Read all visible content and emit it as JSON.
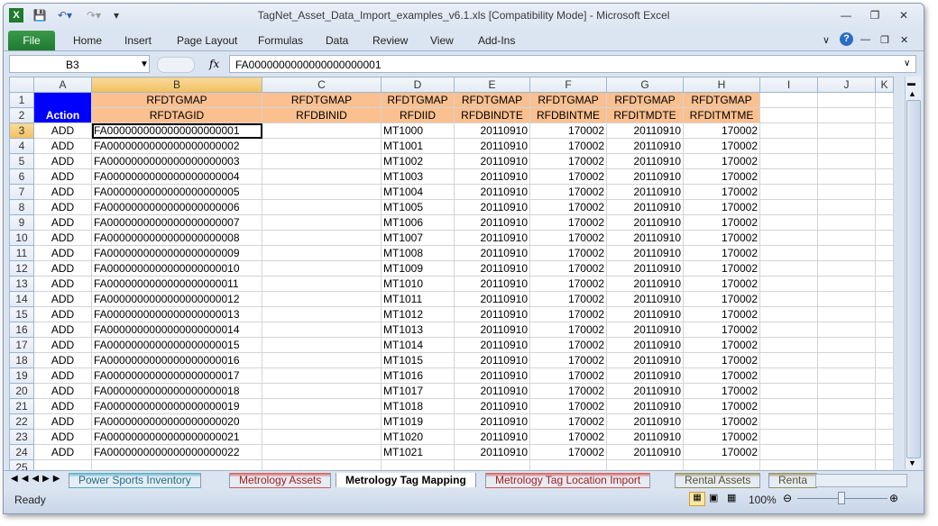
{
  "title": "TagNet_Asset_Data_Import_examples_v6.1.xls  [Compatibility Mode]  -  Microsoft Excel",
  "ribbon_tabs": [
    "File",
    "Home",
    "Insert",
    "Page Layout",
    "Formulas",
    "Data",
    "Review",
    "View",
    "Add-Ins"
  ],
  "namebox": "B3",
  "fx": "fx",
  "formula": "FA0000000000000000000001",
  "col_headers": [
    "A",
    "B",
    "C",
    "D",
    "E",
    "F",
    "G",
    "H",
    "I",
    "J",
    "K"
  ],
  "header_row1": [
    "",
    "RFDTGMAP",
    "RFDTGMAP",
    "RFDTGMAP",
    "RFDTGMAP",
    "RFDTGMAP",
    "RFDTGMAP",
    "RFDTGMAP"
  ],
  "header_row2": [
    "Action",
    "RFDTAGID",
    "RFDBINID",
    "RFDIID",
    "RFDBINDTE",
    "RFDBINTME",
    "RFDITMDTE",
    "RFDITMTME"
  ],
  "rows": [
    [
      "ADD",
      "FA0000000000000000000001",
      "",
      "MT1000",
      "20110910",
      "170002",
      "20110910",
      "170002"
    ],
    [
      "ADD",
      "FA0000000000000000000002",
      "",
      "MT1001",
      "20110910",
      "170002",
      "20110910",
      "170002"
    ],
    [
      "ADD",
      "FA0000000000000000000003",
      "",
      "MT1002",
      "20110910",
      "170002",
      "20110910",
      "170002"
    ],
    [
      "ADD",
      "FA0000000000000000000004",
      "",
      "MT1003",
      "20110910",
      "170002",
      "20110910",
      "170002"
    ],
    [
      "ADD",
      "FA0000000000000000000005",
      "",
      "MT1004",
      "20110910",
      "170002",
      "20110910",
      "170002"
    ],
    [
      "ADD",
      "FA0000000000000000000006",
      "",
      "MT1005",
      "20110910",
      "170002",
      "20110910",
      "170002"
    ],
    [
      "ADD",
      "FA0000000000000000000007",
      "",
      "MT1006",
      "20110910",
      "170002",
      "20110910",
      "170002"
    ],
    [
      "ADD",
      "FA0000000000000000000008",
      "",
      "MT1007",
      "20110910",
      "170002",
      "20110910",
      "170002"
    ],
    [
      "ADD",
      "FA0000000000000000000009",
      "",
      "MT1008",
      "20110910",
      "170002",
      "20110910",
      "170002"
    ],
    [
      "ADD",
      "FA0000000000000000000010",
      "",
      "MT1009",
      "20110910",
      "170002",
      "20110910",
      "170002"
    ],
    [
      "ADD",
      "FA0000000000000000000011",
      "",
      "MT1010",
      "20110910",
      "170002",
      "20110910",
      "170002"
    ],
    [
      "ADD",
      "FA0000000000000000000012",
      "",
      "MT1011",
      "20110910",
      "170002",
      "20110910",
      "170002"
    ],
    [
      "ADD",
      "FA0000000000000000000013",
      "",
      "MT1012",
      "20110910",
      "170002",
      "20110910",
      "170002"
    ],
    [
      "ADD",
      "FA0000000000000000000014",
      "",
      "MT1013",
      "20110910",
      "170002",
      "20110910",
      "170002"
    ],
    [
      "ADD",
      "FA0000000000000000000015",
      "",
      "MT1014",
      "20110910",
      "170002",
      "20110910",
      "170002"
    ],
    [
      "ADD",
      "FA0000000000000000000016",
      "",
      "MT1015",
      "20110910",
      "170002",
      "20110910",
      "170002"
    ],
    [
      "ADD",
      "FA0000000000000000000017",
      "",
      "MT1016",
      "20110910",
      "170002",
      "20110910",
      "170002"
    ],
    [
      "ADD",
      "FA0000000000000000000018",
      "",
      "MT1017",
      "20110910",
      "170002",
      "20110910",
      "170002"
    ],
    [
      "ADD",
      "FA0000000000000000000019",
      "",
      "MT1018",
      "20110910",
      "170002",
      "20110910",
      "170002"
    ],
    [
      "ADD",
      "FA0000000000000000000020",
      "",
      "MT1019",
      "20110910",
      "170002",
      "20110910",
      "170002"
    ],
    [
      "ADD",
      "FA0000000000000000000021",
      "",
      "MT1020",
      "20110910",
      "170002",
      "20110910",
      "170002"
    ],
    [
      "ADD",
      "FA0000000000000000000022",
      "",
      "MT1021",
      "20110910",
      "170002",
      "20110910",
      "170002"
    ]
  ],
  "sheet_tabs": [
    {
      "label": "Power Sports Inventory",
      "color": "#4bacc6"
    },
    {
      "label": "Metrology Assets",
      "color": "#d9534f"
    },
    {
      "label": "Metrology Tag Mapping",
      "color": "#ffffff",
      "active": true
    },
    {
      "label": "Metrology Tag Location Import",
      "color": "#d9534f"
    },
    {
      "label": "Rental Assets",
      "color": "#948a54"
    },
    {
      "label": "Renta",
      "color": "#948a54"
    }
  ],
  "status": {
    "ready": "Ready",
    "zoom": "100%"
  }
}
